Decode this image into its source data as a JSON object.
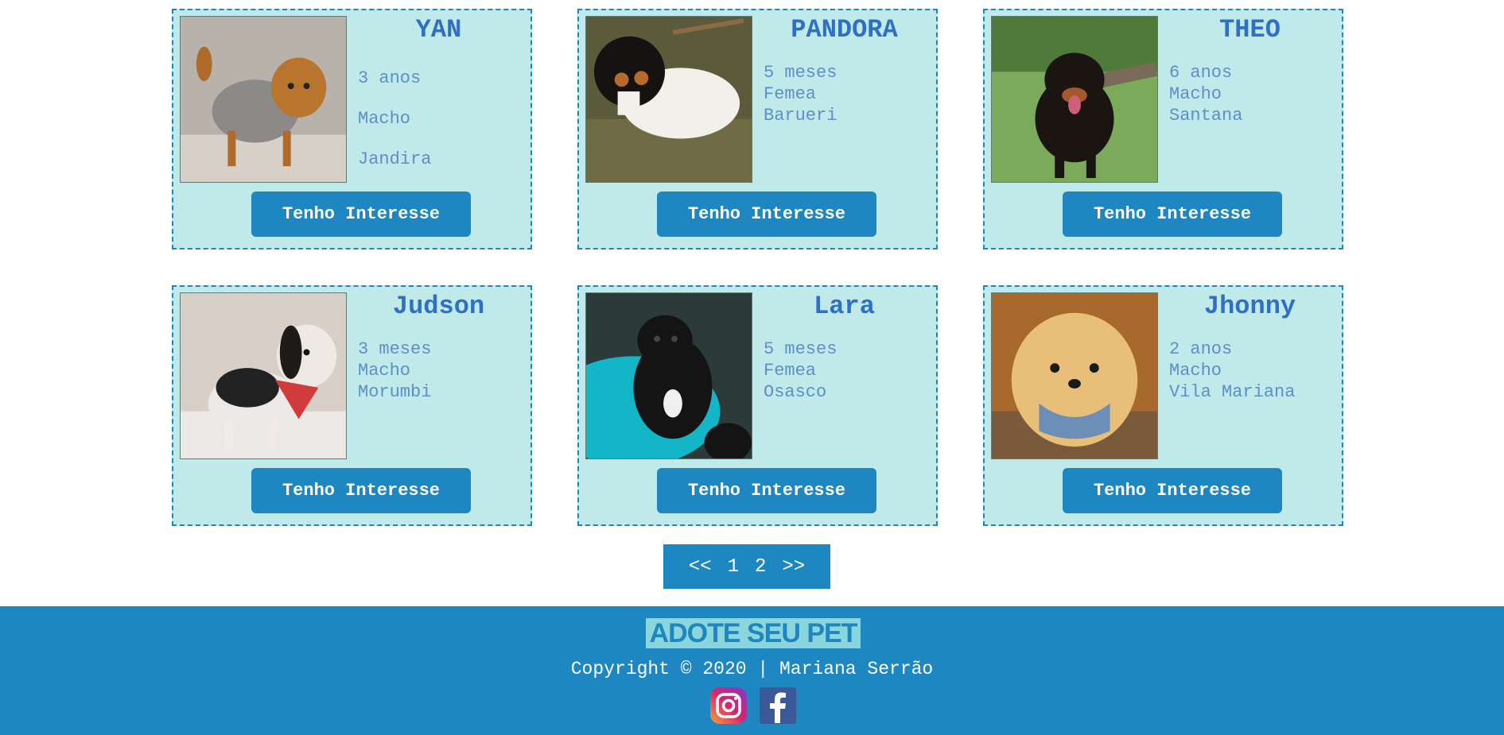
{
  "pets": [
    {
      "name": "YAN",
      "age": "3 anos",
      "sex": "Macho",
      "location": "Jandira",
      "button": "Tenho Interesse"
    },
    {
      "name": "PANDORA",
      "age": "5 meses",
      "sex": "Femea",
      "location": "Barueri",
      "button": "Tenho Interesse"
    },
    {
      "name": "THEO",
      "age": "6 anos",
      "sex": "Macho",
      "location": "Santana",
      "button": "Tenho Interesse"
    },
    {
      "name": "Judson",
      "age": "3 meses",
      "sex": "Macho",
      "location": "Morumbi",
      "button": "Tenho Interesse"
    },
    {
      "name": "Lara",
      "age": "5 meses",
      "sex": "Femea",
      "location": "Osasco",
      "button": "Tenho Interesse"
    },
    {
      "name": "Jhonny",
      "age": "2 anos",
      "sex": "Macho",
      "location": "Vila Mariana",
      "button": "Tenho Interesse"
    }
  ],
  "pagination": {
    "prev": "<<",
    "page1": "1",
    "page2": "2",
    "next": ">>"
  },
  "footer": {
    "logo": "ADOTE SEU PET",
    "copyright": "Copyright © 2020 | Mariana Serrão",
    "icons": [
      "instagram-icon",
      "facebook-icon"
    ]
  },
  "colors": {
    "accent": "#1e86c0",
    "card_bg": "#bfeae9",
    "title": "#2f6fc4",
    "text": "#5f8fc8"
  }
}
